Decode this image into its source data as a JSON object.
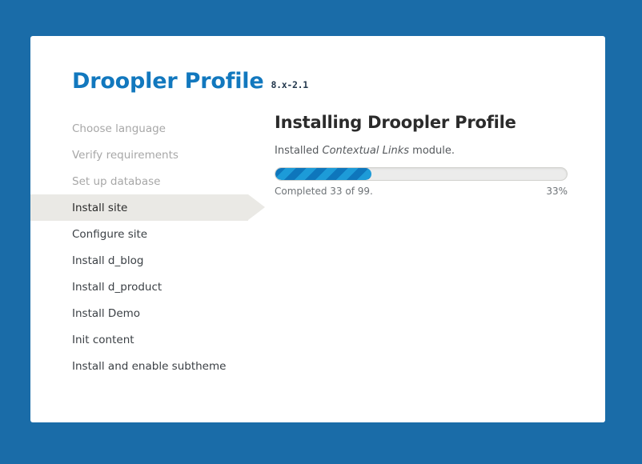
{
  "page": {
    "background_color": "#1a6ca8",
    "card_background": "#ffffff"
  },
  "header": {
    "site_title": "Droopler Profile",
    "version": "8.x-2.1",
    "title_color": "#1278be"
  },
  "sidebar": {
    "items": [
      {
        "label": "Choose language",
        "state": "done"
      },
      {
        "label": "Verify requirements",
        "state": "done"
      },
      {
        "label": "Set up database",
        "state": "done"
      },
      {
        "label": "Install site",
        "state": "active"
      },
      {
        "label": "Configure site",
        "state": "pending"
      },
      {
        "label": "Install d_blog",
        "state": "pending"
      },
      {
        "label": "Install d_product",
        "state": "pending"
      },
      {
        "label": "Install Demo",
        "state": "pending"
      },
      {
        "label": "Init content",
        "state": "pending"
      },
      {
        "label": "Install and enable subtheme",
        "state": "pending"
      }
    ],
    "active_background": "#eae9e5"
  },
  "main": {
    "title": "Installing Droopler Profile",
    "status_prefix": "Installed ",
    "status_emphasis": "Contextual Links",
    "status_suffix": " module.",
    "progress": {
      "percent_value": 33,
      "percent_label": "33%",
      "completed_label": "Completed 33 of 99.",
      "completed_count": 33,
      "total_count": 99,
      "fill_color_dark": "#0e76bc",
      "fill_color_light": "#1d9bd8",
      "track_color": "#ececeb"
    }
  }
}
